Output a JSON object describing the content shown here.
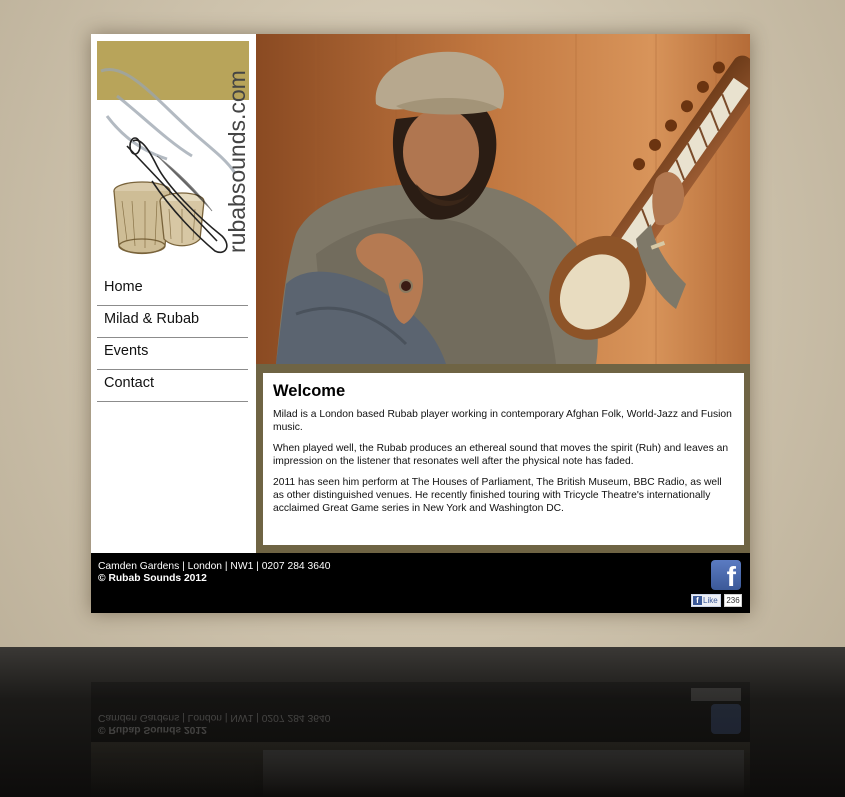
{
  "site": {
    "logo_text": "rubabsounds.com"
  },
  "nav": {
    "items": [
      {
        "label": "Home"
      },
      {
        "label": "Milad & Rubab"
      },
      {
        "label": "Events"
      },
      {
        "label": "Contact"
      }
    ]
  },
  "content": {
    "title": "Welcome",
    "paragraphs": [
      "Milad is a London based Rubab player working in contemporary Afghan Folk, World-Jazz and Fusion music.",
      "When played well, the Rubab produces an ethereal sound that moves the spirit (Ruh) and leaves an impression on the listener that resonates well after the physical note has faded.",
      "2011 has seen him perform at The Houses of Parliament, The British Museum, BBC Radio, as well as other distinguished venues. He recently finished touring with Tricycle Theatre's internationally acclaimed Great Game series in New York and Washington DC."
    ]
  },
  "footer": {
    "address": "Camden Gardens | London | NW1 | 0207 284 3640",
    "copyright": "© Rubab Sounds 2012",
    "facebook_icon": "facebook-icon",
    "like_label": "Like",
    "like_count": "236"
  },
  "colors": {
    "logo_gold": "#b8a45a",
    "content_frame": "#6f6444",
    "facebook_blue": "#3b5998"
  }
}
